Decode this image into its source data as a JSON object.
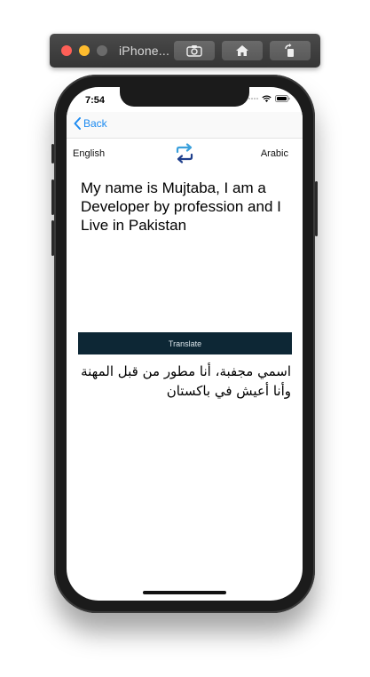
{
  "simulator": {
    "title": "iPhone..."
  },
  "status_bar": {
    "time": "7:54"
  },
  "nav": {
    "back_label": "Back"
  },
  "languages": {
    "source": "English",
    "target": "Arabic"
  },
  "input": {
    "text": "My name is Mujtaba, I am a Developer by profession and I Live in Pakistan"
  },
  "translate_button": {
    "label": "Translate"
  },
  "output": {
    "text": "اسمي مجفبة، أنا مطور من قبل المهنة وأنا أعيش في باكستان"
  },
  "colors": {
    "accent": "#1d8bf1",
    "button_bg": "#0d2735",
    "swap_top": "#3aa0dc",
    "swap_bottom": "#1f3f8c"
  },
  "icons": {
    "back": "chevron-left-icon",
    "swap": "swap-arrows-icon",
    "screenshot": "camera-icon",
    "home": "home-icon",
    "rotate": "rotate-icon",
    "wifi": "wifi-icon",
    "battery": "battery-icon"
  }
}
